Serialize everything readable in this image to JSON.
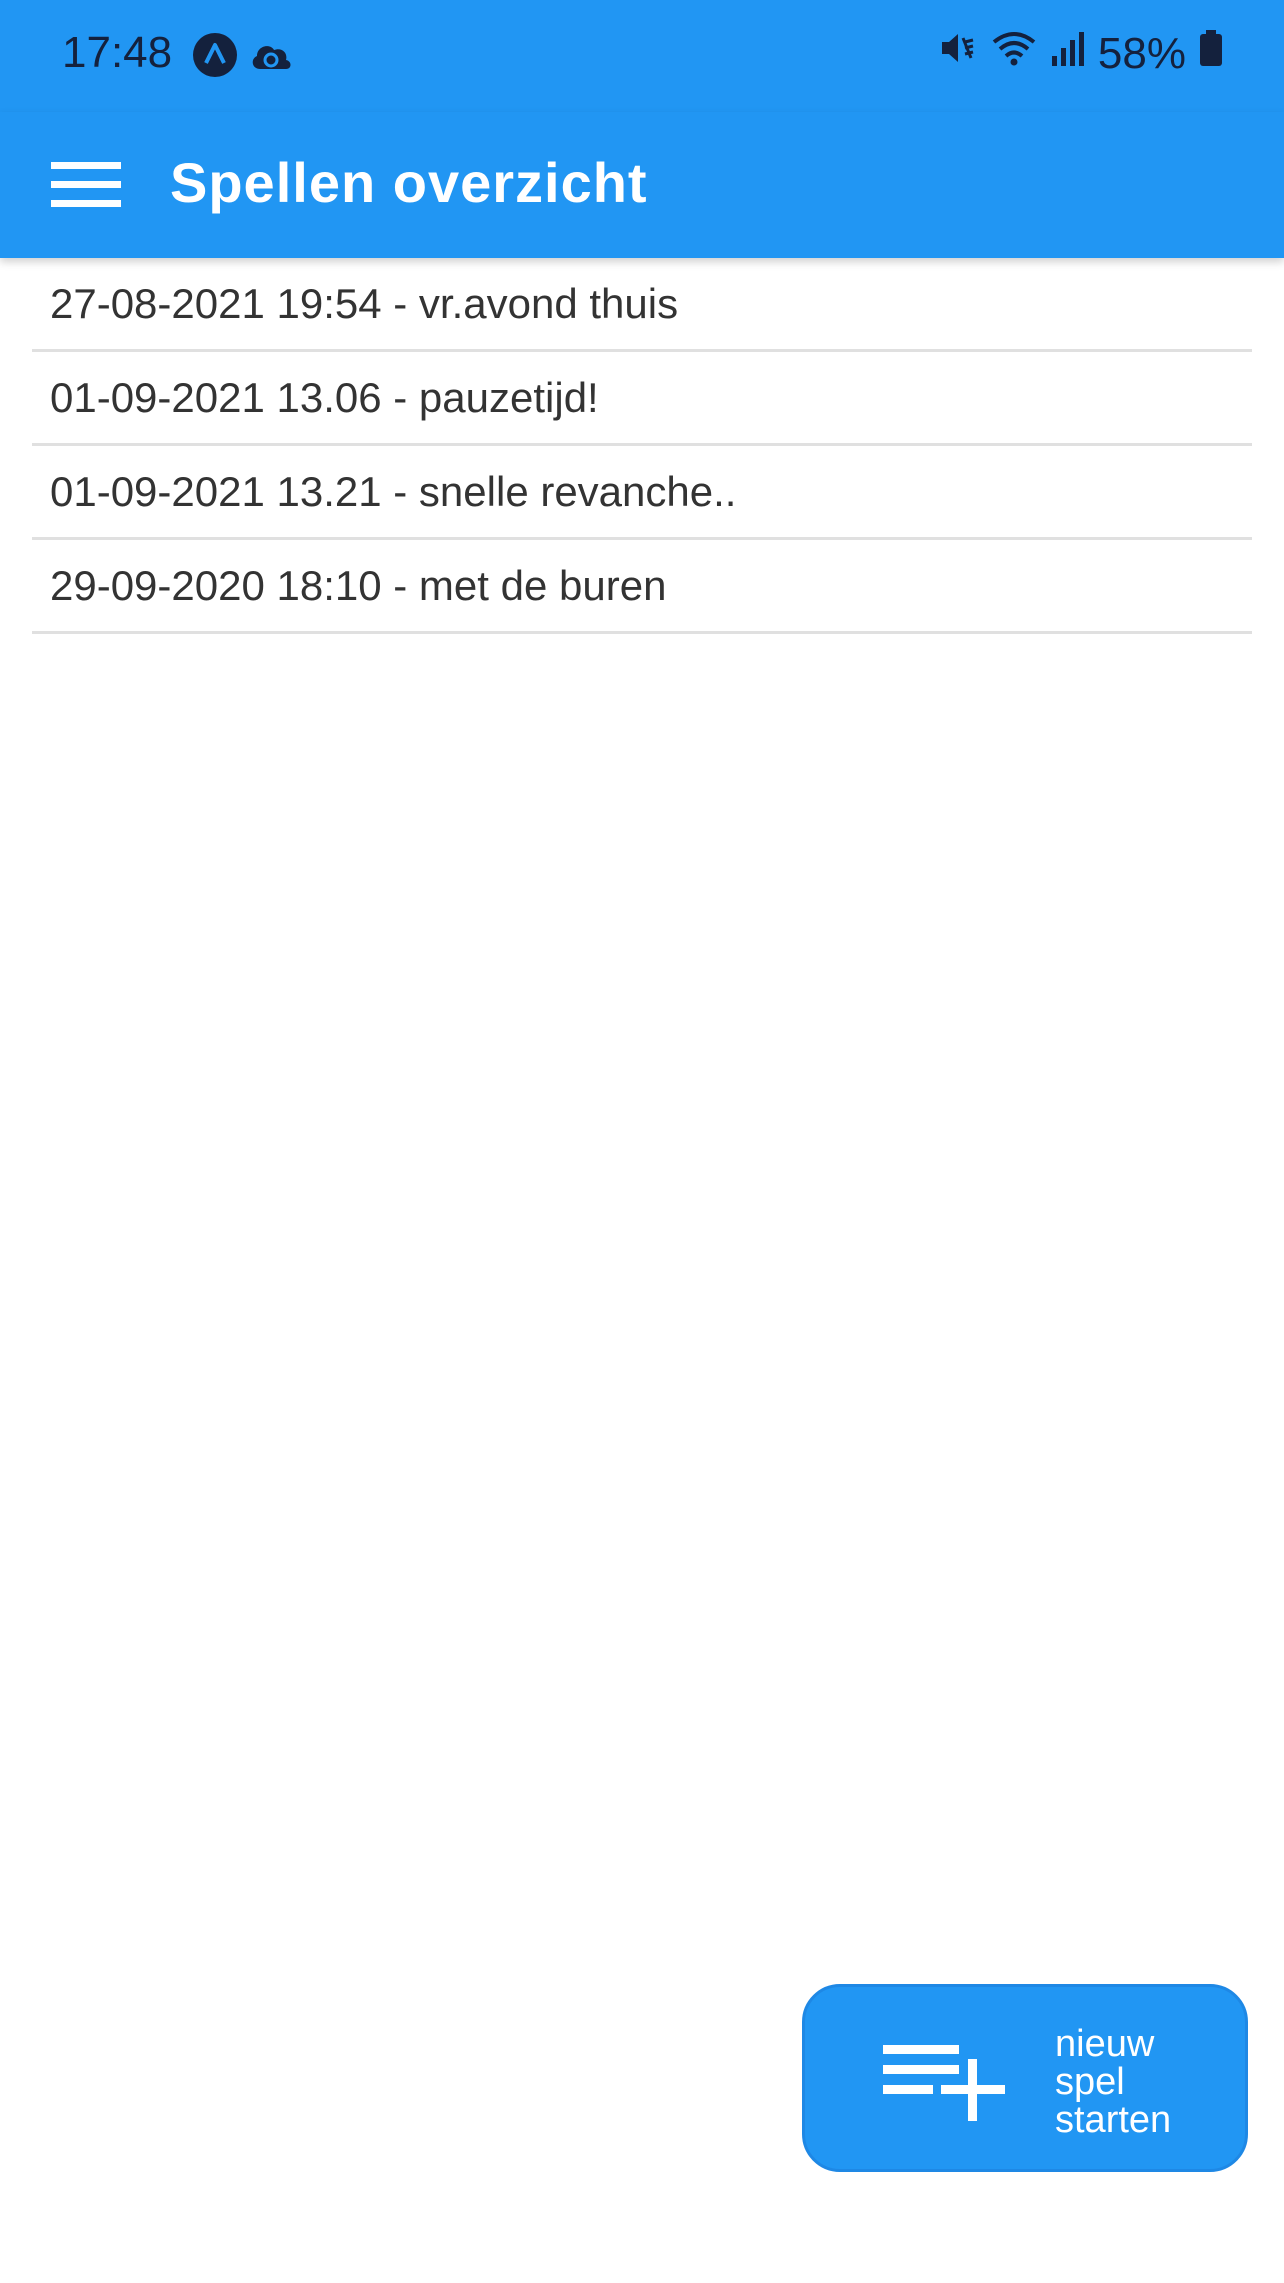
{
  "status_bar": {
    "time": "17:48",
    "battery": "58%",
    "icons": [
      "app-a-icon",
      "cloud-sync-icon",
      "mute-vibrate-icon",
      "wifi-icon",
      "signal-icon",
      "battery-icon"
    ]
  },
  "app_bar": {
    "title": "Spellen overzicht",
    "menu_icon": "hamburger-menu-icon",
    "color": "#2196f3"
  },
  "games": [
    {
      "label": "27-08-2021 19:54 - vr.avond thuis"
    },
    {
      "label": "01-09-2021 13.06 - pauzetijd!"
    },
    {
      "label": "01-09-2021 13.21 - snelle revanche.."
    },
    {
      "label": "29-09-2020 18:10 - met de buren"
    }
  ],
  "fab": {
    "icon": "playlist-add-icon",
    "line1": "nieuw",
    "line2": "spel",
    "line3": "starten"
  }
}
